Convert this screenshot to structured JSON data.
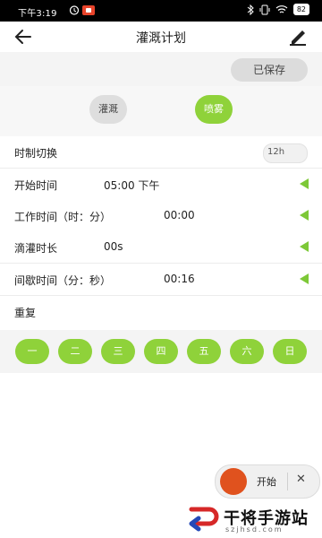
{
  "status_bar": {
    "time": "下午3:19",
    "battery": "82"
  },
  "header": {
    "title": "灌溉计划"
  },
  "saved_button": "已保存",
  "modes": [
    {
      "label": "灌溉",
      "selected": false
    },
    {
      "label": "喷雾",
      "selected": true
    }
  ],
  "time_format": {
    "label": "时制切换",
    "toggle_text": "12h"
  },
  "settings": [
    {
      "label": "开始时间",
      "value": "05:00 下午"
    },
    {
      "label": "工作时间（时：分）",
      "value": "00:00"
    },
    {
      "label": "滴灌时长",
      "value": "00s"
    },
    {
      "label": "间歇时间（分：秒）",
      "value": "00:16"
    }
  ],
  "repeat": {
    "label": "重复",
    "days": [
      "一",
      "二",
      "三",
      "四",
      "五",
      "六",
      "日"
    ]
  },
  "start_control": {
    "label": "开始",
    "close": "✕"
  },
  "watermark": {
    "brand": "干将手游站",
    "url": "szjhsd.com"
  },
  "colors": {
    "accent_green": "#8fd23a",
    "record_red": "#e0521e"
  }
}
